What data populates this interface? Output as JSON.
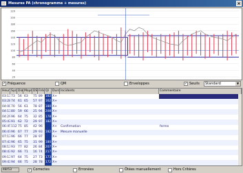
{
  "window": {
    "title": "Mesures PA (chronogramme + mesures)"
  },
  "chart": {
    "yticks": [
      "220",
      "200",
      "180",
      "160",
      "140",
      "120",
      "100",
      "80",
      "60",
      "40",
      "20"
    ],
    "series_up": [
      140,
      135,
      150,
      160,
      145,
      140,
      150,
      155,
      148,
      140,
      150,
      165,
      160,
      150,
      140,
      155,
      150,
      145,
      160,
      150,
      145,
      140,
      150,
      170,
      160,
      150,
      145,
      150,
      155,
      160,
      150,
      140,
      150,
      145,
      150,
      155,
      160,
      150,
      145,
      150,
      160,
      155,
      150,
      140,
      150,
      145,
      150,
      160,
      155,
      150
    ],
    "series_low": [
      80,
      85,
      70,
      90,
      80,
      75,
      95,
      85,
      80,
      90,
      70,
      85,
      80,
      90,
      75,
      85,
      95,
      80,
      70,
      85,
      80,
      90,
      85,
      75,
      80,
      90,
      85,
      80,
      70,
      95,
      85,
      80,
      90,
      75,
      85,
      80,
      90,
      70,
      85,
      80,
      90,
      85,
      75,
      80,
      90,
      85,
      80,
      70,
      85,
      90
    ],
    "pulse": [
      95,
      100,
      110,
      120,
      130,
      125,
      140,
      150,
      145,
      130,
      120,
      115,
      118,
      122,
      125,
      140,
      150,
      160,
      155,
      150,
      145,
      140,
      130,
      125,
      150,
      165,
      160,
      170,
      165,
      150,
      140,
      135,
      130,
      125,
      120,
      118,
      115,
      130,
      140,
      150,
      155,
      160,
      150,
      145,
      140,
      138,
      135,
      130,
      140,
      150
    ],
    "ref_high_left": 140,
    "ref_high_right": 145,
    "ref_low_left": 85,
    "ref_low_right": 80
  },
  "options": {
    "frequence": "Fréquence",
    "qm": "QM",
    "enveloppes": "Enveloppes",
    "seuils": "Seuils",
    "seuils_value": "Standard"
  },
  "table": {
    "headers": [
      "Heure",
      "Syst",
      "Dia",
      "Moyen",
      "DS",
      "Fréq",
      "QI",
      "Durs",
      "Incidents",
      "Commentaire"
    ],
    "rows": [
      [
        "03:13",
        "73",
        "56",
        "63",
        "75",
        "89",
        "182",
        "X+",
        "",
        ""
      ],
      [
        "03:28",
        "74",
        "61",
        "65",
        "57",
        "97",
        "162",
        "X+",
        "",
        ""
      ],
      [
        "04:00",
        "70",
        "56",
        "61",
        "78",
        "87",
        "180",
        "X+",
        "",
        ""
      ],
      [
        "04:13",
        "80",
        "59",
        "66",
        "25",
        "94",
        "208",
        "X+",
        "",
        ""
      ],
      [
        "04:29",
        "96",
        "64",
        "75",
        "32",
        "85",
        "178",
        "X+",
        "",
        ""
      ],
      [
        "05:43",
        "91",
        "62",
        "72",
        "29",
        "97",
        "182",
        "X+",
        "",
        ""
      ],
      [
        "06:45",
        "112",
        "75",
        "85",
        "42",
        "96",
        "",
        "X+",
        "Confirmation",
        "ferme"
      ],
      [
        "06:47",
        "96",
        "67",
        "77",
        "29",
        "93",
        "182",
        "X+",
        "Mesure manuelle",
        ""
      ],
      [
        "07:13",
        "96",
        "66",
        "77",
        "28",
        "97",
        "",
        "X+",
        "",
        ""
      ],
      [
        "07:43",
        "96",
        "65",
        "75",
        "31",
        "99",
        "180",
        "X+",
        "",
        ""
      ],
      [
        "08:13",
        "93",
        "77",
        "82",
        "26",
        "84",
        "207",
        "X+",
        "",
        ""
      ],
      [
        "08:43",
        "92",
        "66",
        "71",
        "16",
        "74",
        "217",
        "X+",
        "",
        ""
      ],
      [
        "09:13",
        "97",
        "64",
        "75",
        "27",
        "73",
        "173",
        "X+",
        "",
        ""
      ],
      [
        "09:43",
        "94",
        "66",
        "75",
        "28",
        "78",
        "172",
        "X+",
        "",
        ""
      ]
    ]
  },
  "status": {
    "count": "48/53",
    "corrects": "Correctes",
    "erronees": "Erronées",
    "otees": "Ôtées manuellement",
    "hors": "Hors Critères"
  }
}
